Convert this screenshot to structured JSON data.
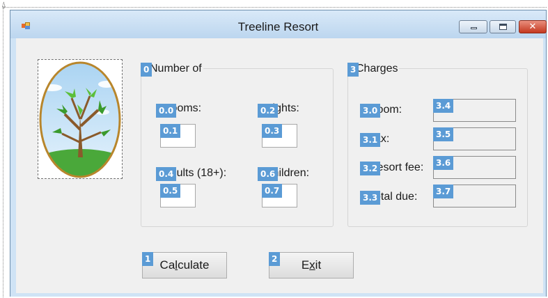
{
  "window": {
    "title": "Treeline Resort",
    "controls": {
      "minimize": "minimize",
      "maximize": "maximize",
      "close": "✕"
    }
  },
  "picture": {
    "icon": "tree-icon",
    "description_shown": ""
  },
  "groups": {
    "number_of": {
      "title": "Number of",
      "tag": "0",
      "labels": [
        {
          "tag": "0.0",
          "text": "Rooms:"
        },
        {
          "tag": "0.2",
          "text": "Nights:"
        },
        {
          "tag": "0.4",
          "text": "Adults (18+):"
        },
        {
          "tag": "0.6",
          "text": "Children:"
        }
      ],
      "inputs": [
        {
          "tag": "0.1",
          "value": ""
        },
        {
          "tag": "0.3",
          "value": ""
        },
        {
          "tag": "0.5",
          "value": ""
        },
        {
          "tag": "0.7",
          "value": ""
        }
      ]
    },
    "charges": {
      "title": "Charges",
      "tag": "3",
      "labels": [
        {
          "tag": "3.0",
          "text": "Room:"
        },
        {
          "tag": "3.1",
          "text": "Tax:"
        },
        {
          "tag": "3.2",
          "text": "Resort fee:"
        },
        {
          "tag": "3.3",
          "text": "Total due:"
        }
      ],
      "outputs": [
        {
          "tag": "3.4",
          "value": ""
        },
        {
          "tag": "3.5",
          "value": ""
        },
        {
          "tag": "3.6",
          "value": ""
        },
        {
          "tag": "3.7",
          "value": ""
        }
      ]
    }
  },
  "buttons": {
    "calculate": {
      "tag": "1",
      "pre": "Ca",
      "hot": "l",
      "post": "culate"
    },
    "exit": {
      "tag": "2",
      "pre": "E",
      "hot": "x",
      "post": "it"
    }
  },
  "colors": {
    "tag_bg": "#5b9bd5",
    "titlebar": "#cfe3f5",
    "client": "#f0f0f0"
  }
}
